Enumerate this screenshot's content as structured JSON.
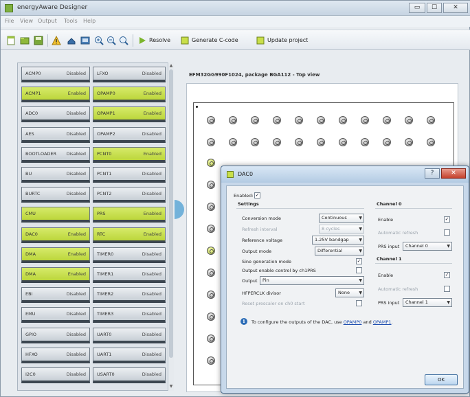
{
  "window": {
    "title": "energyAware Designer",
    "controls": [
      "▭",
      "☐",
      "✕"
    ]
  },
  "menu": [
    "File",
    "View",
    "Output",
    "Tools",
    "Help"
  ],
  "toolbar": {
    "run_label": "Resolve",
    "generate_label": "Generate C-code",
    "update_label": "Update project"
  },
  "peripherals": {
    "left": [
      {
        "name": "ACMP0",
        "state": "Disabled",
        "enabled": false
      },
      {
        "name": "ACMP1",
        "state": "Enabled",
        "enabled": true
      },
      {
        "name": "ADC0",
        "state": "Disabled",
        "enabled": false
      },
      {
        "name": "AES",
        "state": "Disabled",
        "enabled": false
      },
      {
        "name": "BOOTLOADER",
        "state": "Disabled",
        "enabled": false
      },
      {
        "name": "BU",
        "state": "Disabled",
        "enabled": false
      },
      {
        "name": "BURTC",
        "state": "Disabled",
        "enabled": false
      },
      {
        "name": "CMU",
        "state": "",
        "enabled": true
      },
      {
        "name": "DAC0",
        "state": "Enabled",
        "enabled": true
      },
      {
        "name": "DMA",
        "state": "Enabled",
        "enabled": true
      },
      {
        "name": "DMA",
        "state": "Enabled",
        "enabled": true
      },
      {
        "name": "EBI",
        "state": "Disabled",
        "enabled": false
      },
      {
        "name": "EMU",
        "state": "Disabled",
        "enabled": false
      },
      {
        "name": "GPIO",
        "state": "Disabled",
        "enabled": false
      },
      {
        "name": "HFXO",
        "state": "Disabled",
        "enabled": false
      },
      {
        "name": "I2C0",
        "state": "Disabled",
        "enabled": false
      }
    ],
    "right": [
      {
        "name": "LFXO",
        "state": "Disabled",
        "enabled": false
      },
      {
        "name": "OPAMP0",
        "state": "Enabled",
        "enabled": true
      },
      {
        "name": "OPAMP1",
        "state": "Enabled",
        "enabled": true
      },
      {
        "name": "OPAMP2",
        "state": "Disabled",
        "enabled": false
      },
      {
        "name": "PCNT0",
        "state": "Enabled",
        "enabled": true
      },
      {
        "name": "PCNT1",
        "state": "Disabled",
        "enabled": false
      },
      {
        "name": "PCNT2",
        "state": "Disabled",
        "enabled": false
      },
      {
        "name": "PRS",
        "state": "Enabled",
        "enabled": true
      },
      {
        "name": "RTC",
        "state": "Enabled",
        "enabled": true
      },
      {
        "name": "TIMER0",
        "state": "Disabled",
        "enabled": false
      },
      {
        "name": "TIMER1",
        "state": "Disabled",
        "enabled": false
      },
      {
        "name": "TIMER2",
        "state": "Disabled",
        "enabled": false
      },
      {
        "name": "TIMER3",
        "state": "Disabled",
        "enabled": false
      },
      {
        "name": "UART0",
        "state": "Disabled",
        "enabled": false
      },
      {
        "name": "UART1",
        "state": "Disabled",
        "enabled": false
      },
      {
        "name": "USART0",
        "state": "Disabled",
        "enabled": false
      }
    ]
  },
  "chip": {
    "title": "EFM32GG990F1024, package BGA112 - Top view"
  },
  "dialog": {
    "title": "DAC0",
    "help": "?",
    "close": "✕",
    "enabled_label": "Enabled:",
    "enabled_checked": "✓",
    "settings_title": "Settings",
    "conversion_mode_label": "Conversion mode",
    "conversion_mode_value": "Continuous",
    "refresh_interval_label": "Refresh interval",
    "refresh_interval_value": "8 cycles",
    "reference_voltage_label": "Reference voltage",
    "reference_voltage_value": "1.25V bandgap",
    "output_mode_label": "Output mode",
    "output_mode_value": "Differential",
    "sine_label": "Sine generation mode",
    "sine_checked": "✓",
    "output_enable_prs_label": "Output enable control by ch1PRS",
    "output_enable_prs_checked": "",
    "output_label": "Output",
    "output_value": "Pin",
    "hfperclk_label": "HFPERCLK divisor",
    "hfperclk_value": "None",
    "reset_prescaler_label": "Reset prescaler on ch0 start",
    "reset_prescaler_checked": "",
    "channel0": {
      "title": "Channel 0",
      "enable_label": "Enable",
      "enable_checked": "✓",
      "auto_refresh_label": "Automatic refresh",
      "auto_refresh_checked": "",
      "prs_input_label": "PRS input",
      "prs_input_value": "Channel 0"
    },
    "channel1": {
      "title": "Channel 1",
      "enable_label": "Enable",
      "enable_checked": "✓",
      "auto_refresh_label": "Automatic refresh",
      "auto_refresh_checked": "",
      "prs_input_label": "PRS input",
      "prs_input_value": "Channel 1"
    },
    "info_text": "To configure the outputs of the DAC, use",
    "info_link1": "OPAMP0",
    "info_and": "and",
    "info_link2": "OPAMP1",
    "info_end": ".",
    "ok_label": "OK"
  },
  "colors": {
    "enabled": "#c4dc46",
    "disabled": "#dde2e7",
    "accent": "#2b6cb6"
  }
}
